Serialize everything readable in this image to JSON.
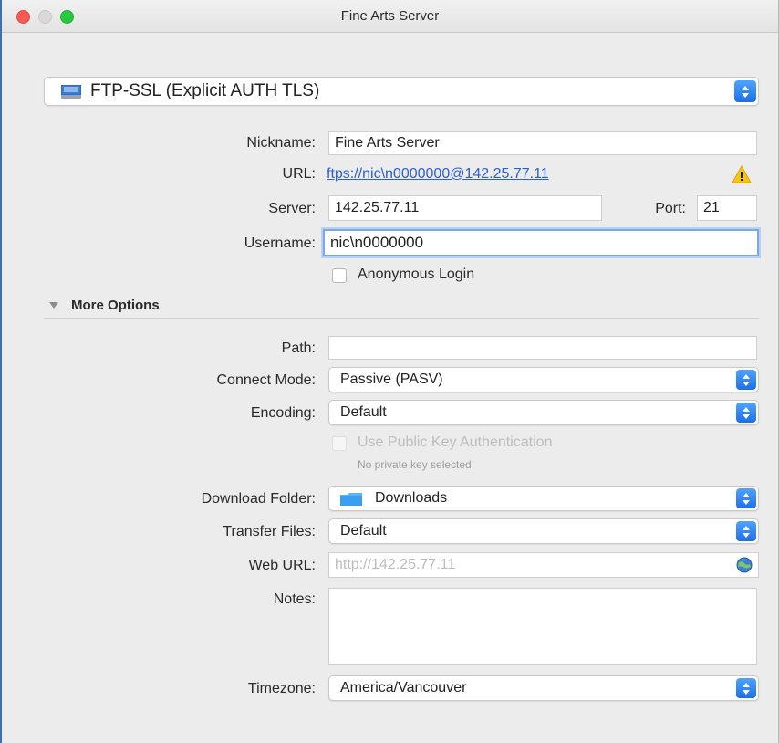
{
  "window": {
    "title": "Fine Arts Server"
  },
  "protocol": {
    "selected": "FTP-SSL (Explicit AUTH TLS)"
  },
  "form": {
    "nickname_label": "Nickname:",
    "nickname_value": "Fine Arts Server",
    "url_label": "URL:",
    "url_value": "ftps://nic\\n0000000@142.25.77.11",
    "server_label": "Server:",
    "server_value": "142.25.77.11",
    "port_label": "Port:",
    "port_value": "21",
    "username_label": "Username:",
    "username_value": "nic\\n0000000",
    "anonymous_label": "Anonymous Login"
  },
  "more_options": {
    "label": "More Options",
    "path_label": "Path:",
    "path_value": "",
    "connect_mode_label": "Connect Mode:",
    "connect_mode_value": "Passive (PASV)",
    "encoding_label": "Encoding:",
    "encoding_value": "Default",
    "public_key_label": "Use Public Key Authentication",
    "public_key_sub": "No private key selected",
    "download_folder_label": "Download Folder:",
    "download_folder_value": "Downloads",
    "transfer_files_label": "Transfer Files:",
    "transfer_files_value": "Default",
    "web_url_label": "Web URL:",
    "web_url_placeholder": "http://142.25.77.11",
    "notes_label": "Notes:",
    "notes_value": "",
    "timezone_label": "Timezone:",
    "timezone_value": "America/Vancouver"
  },
  "colors": {
    "accent": "#1d6fe8",
    "link": "#2c5fd0",
    "warning": "#f5c518"
  },
  "icons": {
    "protocol": "disk-icon",
    "url_status": "warning-icon",
    "folder": "folder-icon",
    "web": "globe-icon"
  }
}
